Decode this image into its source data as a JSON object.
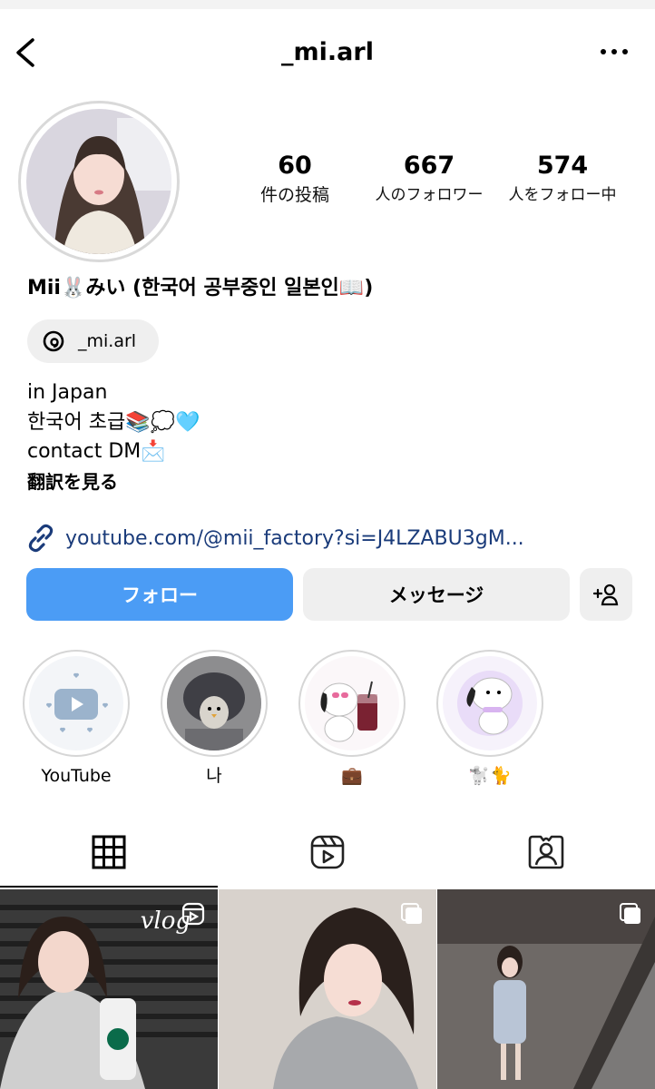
{
  "header": {
    "username": "_mi.arl"
  },
  "stats": [
    {
      "value": "60",
      "label": "件の投稿"
    },
    {
      "value": "667",
      "label": "人のフォロワー"
    },
    {
      "value": "574",
      "label": "人をフォロー中"
    }
  ],
  "profile": {
    "display_name": "Mii🐰みい (한국어 공부중인 일본인📖)",
    "threads_handle": "_mi.arl",
    "bio_lines": [
      "in Japan",
      "한국어 초급📚💭🩵",
      "contact DM📩"
    ],
    "translate": "翻訳を見る",
    "link": "youtube.com/@mii_factory?si=J4LZABU3gM..."
  },
  "actions": {
    "follow": "フォロー",
    "message": "メッセージ"
  },
  "highlights": [
    {
      "label": "YouTube",
      "icon": "youtube-heart-icon"
    },
    {
      "label": "나",
      "icon": "photo"
    },
    {
      "label": "💼",
      "icon": "pochacco-drink"
    },
    {
      "label": "🐩🐈",
      "icon": "pochacco"
    }
  ],
  "tabs": [
    {
      "name": "grid",
      "icon": "grid-icon",
      "active": true
    },
    {
      "name": "reels",
      "icon": "reels-icon",
      "active": false
    },
    {
      "name": "tagged",
      "icon": "tagged-icon",
      "active": false
    }
  ],
  "posts": [
    {
      "overlay_text": "vlog",
      "type": "reel"
    },
    {
      "overlay_text": "",
      "type": "carousel"
    },
    {
      "overlay_text": "",
      "type": "carousel"
    }
  ],
  "colors": {
    "accent": "#4b9cf5",
    "link": "#1a3b7a",
    "button_gray": "#efefef"
  }
}
